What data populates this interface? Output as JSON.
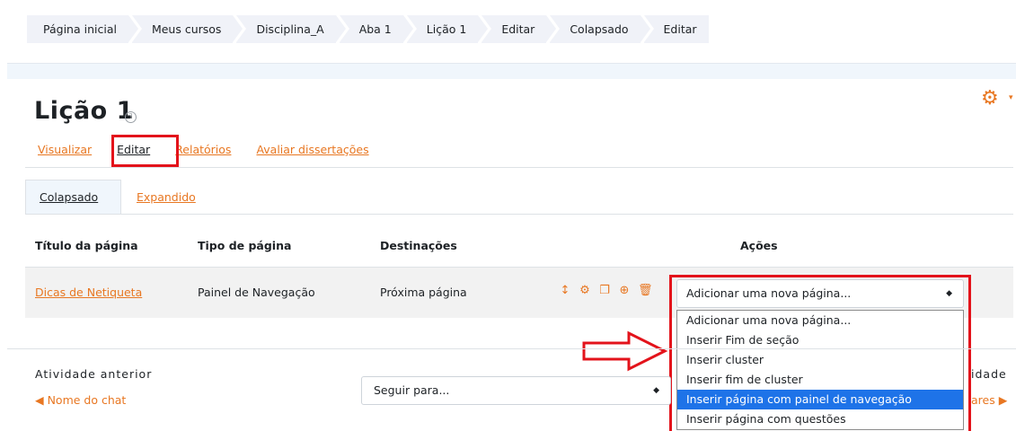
{
  "breadcrumb": [
    "Página inicial",
    "Meus cursos",
    "Disciplina_A",
    "Aba 1",
    "Lição 1",
    "Editar",
    "Colapsado",
    "Editar"
  ],
  "page": {
    "title": "Lição 1",
    "help_glyph": "?"
  },
  "tabs_primary": [
    "Visualizar",
    "Editar",
    "Relatórios",
    "Avaliar dissertações"
  ],
  "tabs_secondary": [
    "Colapsado",
    "Expandido"
  ],
  "table": {
    "headers": [
      "Título da página",
      "Tipo de página",
      "Destinações",
      "Ações"
    ],
    "rows": [
      {
        "title": "Dicas de Netiqueta",
        "type": "Painel de Navegação",
        "destination": "Próxima página"
      }
    ]
  },
  "action_icons": [
    "move-icon",
    "gear-icon",
    "copy-icon",
    "preview-icon",
    "trash-icon"
  ],
  "add_page_select": {
    "value": "Adicionar uma nova página...",
    "options": [
      "Adicionar uma nova página...",
      "Inserir Fim de seção",
      "Inserir cluster",
      "Inserir fim de cluster",
      "Inserir página com painel de navegação",
      "Inserir página com questões"
    ],
    "highlighted_index": 4
  },
  "nav": {
    "prev_label": "Atividade anterior",
    "prev_link": "◀ Nome do chat",
    "jump_value": "Seguir para...",
    "next_label": "idade",
    "next_link": "ares ▶"
  },
  "colors": {
    "accent": "#e87722",
    "highlight_red": "#e3131b",
    "option_selected": "#1e73e8"
  }
}
